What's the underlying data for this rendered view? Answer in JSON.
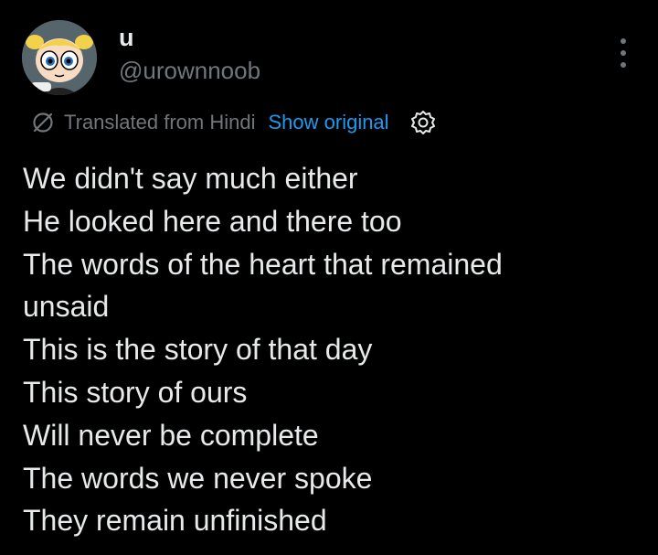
{
  "author": {
    "display_name": "u",
    "handle": "@urownnoob",
    "avatar_icon": "cartoon-girl-avatar-icon"
  },
  "menu": {
    "more_icon": "more-vertical-icon"
  },
  "translation": {
    "icon": "translate-slash-icon",
    "label": "Translated from Hindi",
    "show_original": "Show original",
    "settings_icon": "gear-icon"
  },
  "post": {
    "lines": [
      "We didn't say much either",
      "He looked here and there too",
      "The words of the heart that remained",
      "unsaid",
      "This is the story of that day",
      "This story of ours",
      "Will never be complete",
      "The words we never spoke",
      "They remain unfinished"
    ]
  },
  "colors": {
    "background": "#000000",
    "text_primary": "#e7e9ea",
    "text_secondary": "#71767b",
    "link": "#1d9bf0"
  }
}
